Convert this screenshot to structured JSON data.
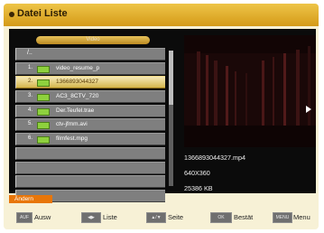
{
  "window": {
    "title": "Datei Liste"
  },
  "folder_tab": "Video",
  "files": [
    {
      "num": "",
      "name": "/.."
    },
    {
      "num": "1.",
      "name": "video_resume_p"
    },
    {
      "num": "2.",
      "name": "1366893044327"
    },
    {
      "num": "3.",
      "name": "AC3_8CTV_720"
    },
    {
      "num": "4.",
      "name": "Der.Teufel.trae"
    },
    {
      "num": "5.",
      "name": "ctv-jfmm.avi"
    },
    {
      "num": "6.",
      "name": "filmfest.mpg"
    }
  ],
  "selected_index": 2,
  "info": {
    "filename": "1366893044327.mp4",
    "resolution": "640X360",
    "size": "25386 KB"
  },
  "action_button": "Ändern",
  "legend": [
    {
      "key": "AUF",
      "label": "Ausw"
    },
    {
      "key": "◀▶",
      "label": "Liste"
    },
    {
      "key": "▲/▼",
      "label": "Seite"
    },
    {
      "key": "OK",
      "label": "Bestät"
    },
    {
      "key": "MENU",
      "label": "Menu"
    }
  ]
}
